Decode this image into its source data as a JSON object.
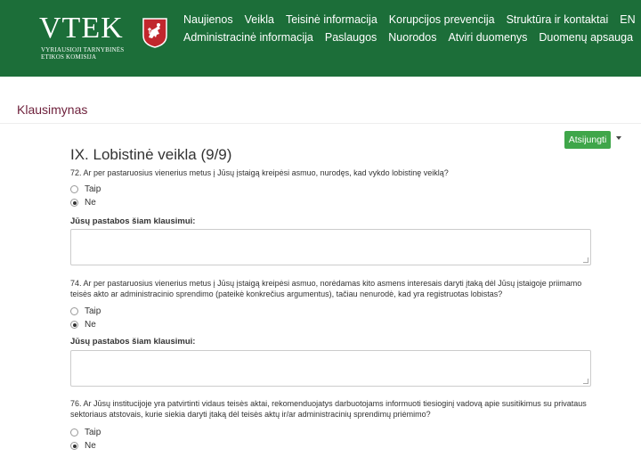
{
  "header": {
    "logo_title": "VTEK",
    "logo_subtitle": "VYRIAUSIOJI TARNYBINĖS ETIKOS KOMISIJA",
    "nav_row1": [
      "Naujienos",
      "Veikla",
      "Teisinė informacija",
      "Korupcijos prevencija",
      "Struktūra ir kontaktai",
      "EN"
    ],
    "nav_row2": [
      "Administracinė informacija",
      "Paslaugos",
      "Nuorodos",
      "Atviri duomenys",
      "Duomenų apsauga"
    ]
  },
  "section": {
    "title": "Klausimynas"
  },
  "user": {
    "logout_label": "Atsijungti"
  },
  "questionnaire": {
    "heading": "IX. Lobistinė veikla (9/9)",
    "notes_label": "Jūsų pastabos šiam klausimui:",
    "options": [
      "Taip",
      "Ne"
    ],
    "questions": [
      {
        "text": "72. Ar per pastaruosius vienerius metus į Jūsų įstaigą kreipėsi asmuo, nurodęs, kad vykdo lobistinę veiklą?",
        "selected": "Ne"
      },
      {
        "text": "74. Ar per pastaruosius vienerius metus į Jūsų įstaigą kreipėsi asmuo, norėdamas kito asmens interesais daryti įtaką dėl Jūsų įstaigoje priimamo teisės akto ar administracinio sprendimo (pateikė konkrečius argumentus), tačiau nenurodė, kad yra registruotas lobistas?",
        "selected": "Ne"
      },
      {
        "text": "76. Ar Jūsų institucijoje yra patvirtinti vidaus teisės aktai, rekomenduojatys darbuotojams informuoti tiesioginį vadovą apie susitikimus su privataus sektoriaus atstovais, kurie siekia daryti įtaką dėl teisės aktų ir/ar administracinių sprendimų priėmimo?",
        "selected": "Ne"
      }
    ]
  },
  "colors": {
    "header_bg": "#1c6e39",
    "section_title": "#6d1f3a",
    "logout_bg": "#3fa64a"
  },
  "icons": [
    "lithuanian-coat-of-arms-icon",
    "caret-down-icon",
    "radio-icon",
    "textarea-resize-icon"
  ]
}
